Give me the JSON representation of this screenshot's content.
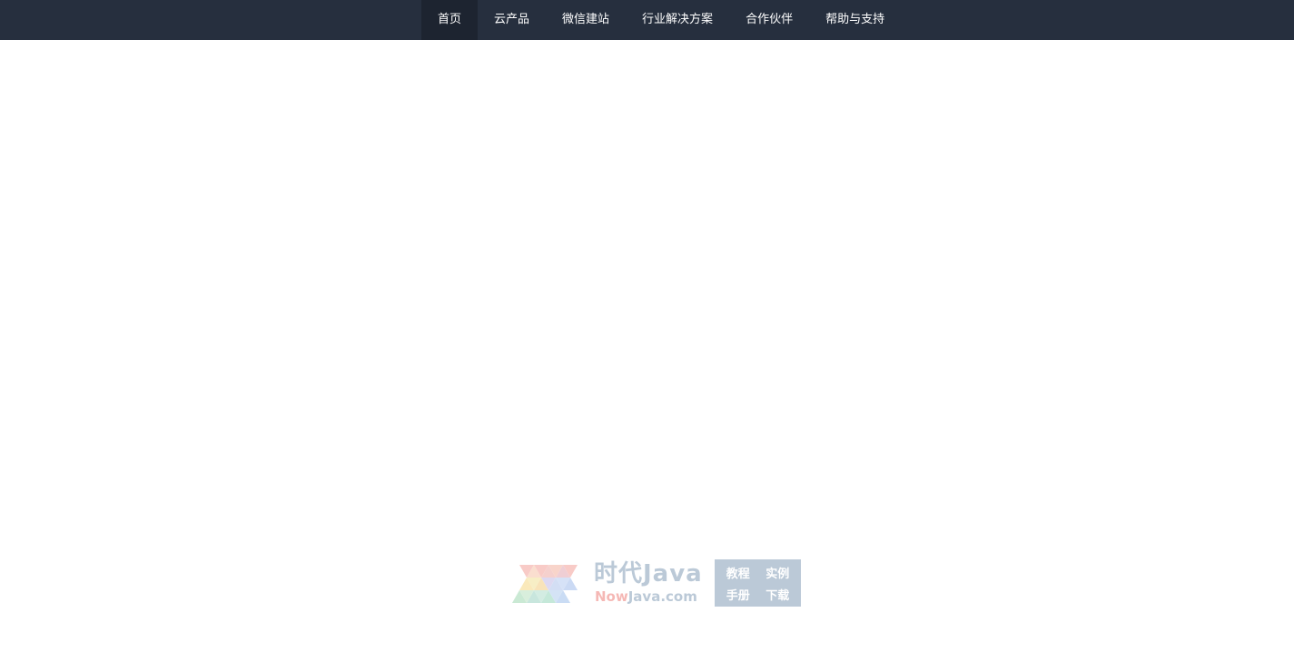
{
  "nav": {
    "items": [
      {
        "label": "首页",
        "active": true
      },
      {
        "label": "云产品",
        "active": false
      },
      {
        "label": "微信建站",
        "active": false
      },
      {
        "label": "行业解决方案",
        "active": false
      },
      {
        "label": "合作伙伴",
        "active": false
      },
      {
        "label": "帮助与支持",
        "active": false
      }
    ]
  },
  "watermark": {
    "title": "时代Java",
    "url_highlight": "Now",
    "url_rest": "Java.com",
    "box": [
      "教程",
      "实例",
      "手册",
      "下载"
    ]
  },
  "colors": {
    "nav_bg": "#262f3e",
    "nav_active_bg": "#1d2430",
    "watermark_blue": "#8ea6bd",
    "watermark_red": "#f08a85"
  }
}
